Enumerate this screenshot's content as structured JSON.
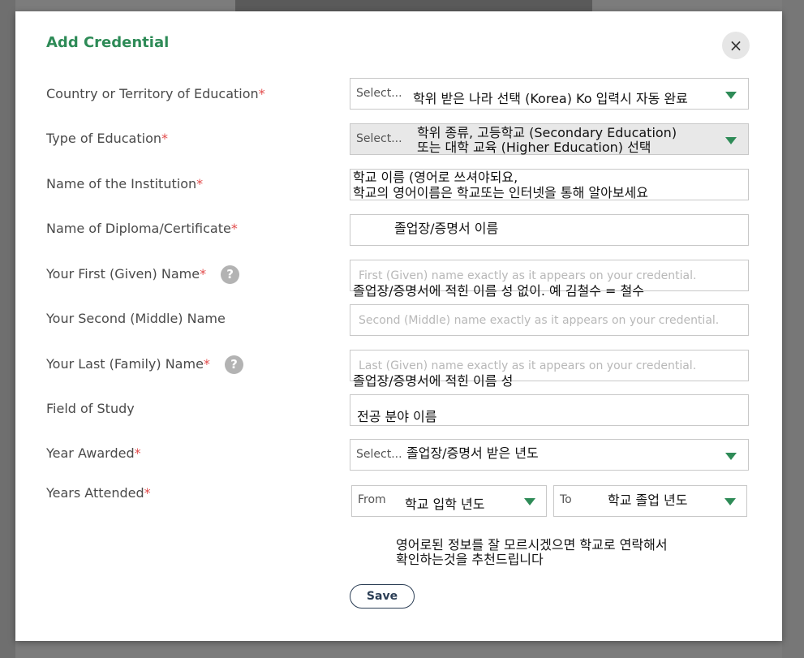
{
  "modal": {
    "title": "Add Credential",
    "close_label": "×",
    "save_label": "Save"
  },
  "labels": {
    "country": "Country or Territory of Education",
    "type": "Type of Education",
    "institution": "Name of the Institution",
    "diploma": "Name of Diploma/Certificate",
    "first_name": "Your First (Given) Name",
    "second_name": "Your Second (Middle) Name",
    "last_name": "Your Last (Family) Name",
    "field": "Field of Study",
    "year": "Year Awarded",
    "years_attended": "Years Attended",
    "required_mark": "*",
    "help_mark": "?"
  },
  "fields": {
    "country_select": "Select...",
    "type_select": "Select...",
    "year_select": "Select...",
    "from_select": "From",
    "to_select": "To",
    "first_placeholder": "First (Given) name exactly as it appears on your credential.",
    "second_placeholder": "Second (Middle) name exactly as it appears on your credential.",
    "last_placeholder": "Last (Given) name exactly as it appears on your credential."
  },
  "annotations": {
    "country": "학위 받은 나라 선택 (Korea) Ko 입력시 자동 완료",
    "type_line1": "학위 종류, 고등학교 (Secondary Education)",
    "type_line2": "또는 대학 교육 (Higher Education) 선택",
    "institution_line1": "학교 이름 (영어로 쓰셔야되요,",
    "institution_line2": "학교의 영어이름은 학교또는 인터넷을 통해 알아보세요",
    "diploma": "졸업장/증명서 이름",
    "first_name": "졸업장/증명서에 적힌 이름 성 없이. 예 김철수 = 철수",
    "last_name": "졸업장/증명서에 적힌 이름 성",
    "field": "전공 분야 이름",
    "year": "졸업장/증명서 받은 년도",
    "from": "학교 입학 년도",
    "to": "학교 졸업 년도",
    "footer_line1": "영어로된 정보를 잘 모르시겠으면 학교로 연락해서",
    "footer_line2": "확인하는것을 추천드립니다"
  },
  "colors": {
    "accent": "#2e8b57",
    "required": "#e24b4b",
    "overlay": "#7c7c7c"
  }
}
